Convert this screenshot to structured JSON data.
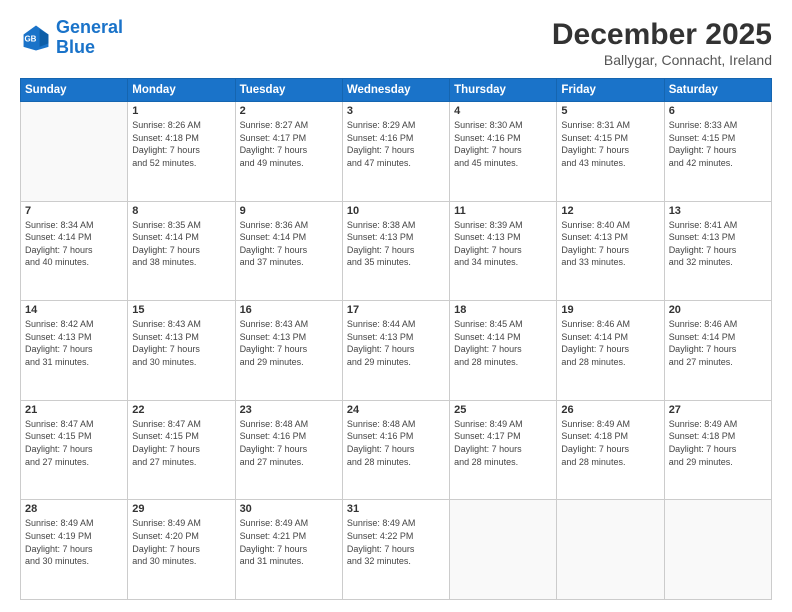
{
  "header": {
    "logo_line1": "General",
    "logo_line2": "Blue",
    "main_title": "December 2025",
    "sub_title": "Ballygar, Connacht, Ireland"
  },
  "calendar": {
    "headers": [
      "Sunday",
      "Monday",
      "Tuesday",
      "Wednesday",
      "Thursday",
      "Friday",
      "Saturday"
    ],
    "rows": [
      [
        {
          "day": "",
          "info": ""
        },
        {
          "day": "1",
          "info": "Sunrise: 8:26 AM\nSunset: 4:18 PM\nDaylight: 7 hours\nand 52 minutes."
        },
        {
          "day": "2",
          "info": "Sunrise: 8:27 AM\nSunset: 4:17 PM\nDaylight: 7 hours\nand 49 minutes."
        },
        {
          "day": "3",
          "info": "Sunrise: 8:29 AM\nSunset: 4:16 PM\nDaylight: 7 hours\nand 47 minutes."
        },
        {
          "day": "4",
          "info": "Sunrise: 8:30 AM\nSunset: 4:16 PM\nDaylight: 7 hours\nand 45 minutes."
        },
        {
          "day": "5",
          "info": "Sunrise: 8:31 AM\nSunset: 4:15 PM\nDaylight: 7 hours\nand 43 minutes."
        },
        {
          "day": "6",
          "info": "Sunrise: 8:33 AM\nSunset: 4:15 PM\nDaylight: 7 hours\nand 42 minutes."
        }
      ],
      [
        {
          "day": "7",
          "info": "Sunrise: 8:34 AM\nSunset: 4:14 PM\nDaylight: 7 hours\nand 40 minutes."
        },
        {
          "day": "8",
          "info": "Sunrise: 8:35 AM\nSunset: 4:14 PM\nDaylight: 7 hours\nand 38 minutes."
        },
        {
          "day": "9",
          "info": "Sunrise: 8:36 AM\nSunset: 4:14 PM\nDaylight: 7 hours\nand 37 minutes."
        },
        {
          "day": "10",
          "info": "Sunrise: 8:38 AM\nSunset: 4:13 PM\nDaylight: 7 hours\nand 35 minutes."
        },
        {
          "day": "11",
          "info": "Sunrise: 8:39 AM\nSunset: 4:13 PM\nDaylight: 7 hours\nand 34 minutes."
        },
        {
          "day": "12",
          "info": "Sunrise: 8:40 AM\nSunset: 4:13 PM\nDaylight: 7 hours\nand 33 minutes."
        },
        {
          "day": "13",
          "info": "Sunrise: 8:41 AM\nSunset: 4:13 PM\nDaylight: 7 hours\nand 32 minutes."
        }
      ],
      [
        {
          "day": "14",
          "info": "Sunrise: 8:42 AM\nSunset: 4:13 PM\nDaylight: 7 hours\nand 31 minutes."
        },
        {
          "day": "15",
          "info": "Sunrise: 8:43 AM\nSunset: 4:13 PM\nDaylight: 7 hours\nand 30 minutes."
        },
        {
          "day": "16",
          "info": "Sunrise: 8:43 AM\nSunset: 4:13 PM\nDaylight: 7 hours\nand 29 minutes."
        },
        {
          "day": "17",
          "info": "Sunrise: 8:44 AM\nSunset: 4:13 PM\nDaylight: 7 hours\nand 29 minutes."
        },
        {
          "day": "18",
          "info": "Sunrise: 8:45 AM\nSunset: 4:14 PM\nDaylight: 7 hours\nand 28 minutes."
        },
        {
          "day": "19",
          "info": "Sunrise: 8:46 AM\nSunset: 4:14 PM\nDaylight: 7 hours\nand 28 minutes."
        },
        {
          "day": "20",
          "info": "Sunrise: 8:46 AM\nSunset: 4:14 PM\nDaylight: 7 hours\nand 27 minutes."
        }
      ],
      [
        {
          "day": "21",
          "info": "Sunrise: 8:47 AM\nSunset: 4:15 PM\nDaylight: 7 hours\nand 27 minutes."
        },
        {
          "day": "22",
          "info": "Sunrise: 8:47 AM\nSunset: 4:15 PM\nDaylight: 7 hours\nand 27 minutes."
        },
        {
          "day": "23",
          "info": "Sunrise: 8:48 AM\nSunset: 4:16 PM\nDaylight: 7 hours\nand 27 minutes."
        },
        {
          "day": "24",
          "info": "Sunrise: 8:48 AM\nSunset: 4:16 PM\nDaylight: 7 hours\nand 28 minutes."
        },
        {
          "day": "25",
          "info": "Sunrise: 8:49 AM\nSunset: 4:17 PM\nDaylight: 7 hours\nand 28 minutes."
        },
        {
          "day": "26",
          "info": "Sunrise: 8:49 AM\nSunset: 4:18 PM\nDaylight: 7 hours\nand 28 minutes."
        },
        {
          "day": "27",
          "info": "Sunrise: 8:49 AM\nSunset: 4:18 PM\nDaylight: 7 hours\nand 29 minutes."
        }
      ],
      [
        {
          "day": "28",
          "info": "Sunrise: 8:49 AM\nSunset: 4:19 PM\nDaylight: 7 hours\nand 30 minutes."
        },
        {
          "day": "29",
          "info": "Sunrise: 8:49 AM\nSunset: 4:20 PM\nDaylight: 7 hours\nand 30 minutes."
        },
        {
          "day": "30",
          "info": "Sunrise: 8:49 AM\nSunset: 4:21 PM\nDaylight: 7 hours\nand 31 minutes."
        },
        {
          "day": "31",
          "info": "Sunrise: 8:49 AM\nSunset: 4:22 PM\nDaylight: 7 hours\nand 32 minutes."
        },
        {
          "day": "",
          "info": ""
        },
        {
          "day": "",
          "info": ""
        },
        {
          "day": "",
          "info": ""
        }
      ]
    ]
  }
}
